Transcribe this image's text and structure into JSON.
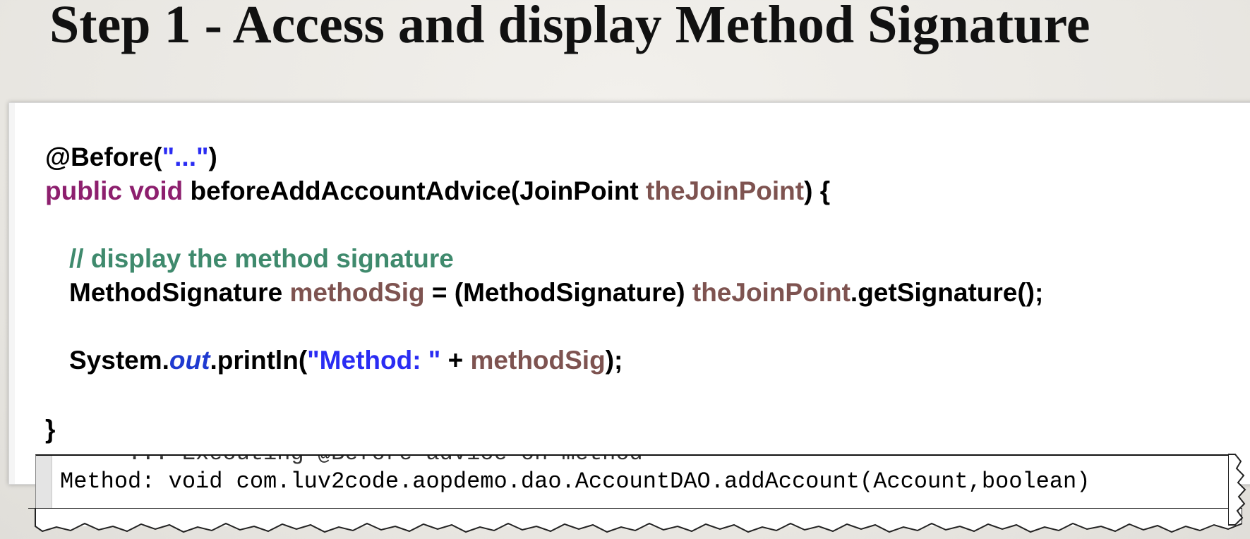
{
  "slide": {
    "title": "Step 1 - Access and display Method Signature"
  },
  "code": {
    "l1_at": "@Before(",
    "l1_str": "\"...\"",
    "l1_close": ")",
    "l2_kw": "public void",
    "l2_mid": " beforeAddAccountAdvice(JoinPoint ",
    "l2_var": "theJoinPoint",
    "l2_end": ") {",
    "l3_comment": "// display the method signature",
    "l4_a": "MethodSignature ",
    "l4_var1": "methodSig",
    "l4_b": " = (MethodSignature) ",
    "l4_var2": "theJoinPoint",
    "l4_c": ".getSignature();",
    "l5_a": "System.",
    "l5_field": "out",
    "l5_b": ".println(",
    "l5_str": "\"Method: \"",
    "l5_c": " + ",
    "l5_var": "methodSig",
    "l5_d": ");",
    "l6_brace": "}"
  },
  "console": {
    "ghost_line": "... Executing @Before advice on method",
    "output_line": "Method: void com.luv2code.aopdemo.dao.AccountDAO.addAccount(Account,boolean)"
  },
  "colors": {
    "keyword": "#8d1f6e",
    "string": "#2a2cf3",
    "variable": "#7e5350",
    "comment": "#3f8a6d",
    "field": "#1f3ad0"
  }
}
